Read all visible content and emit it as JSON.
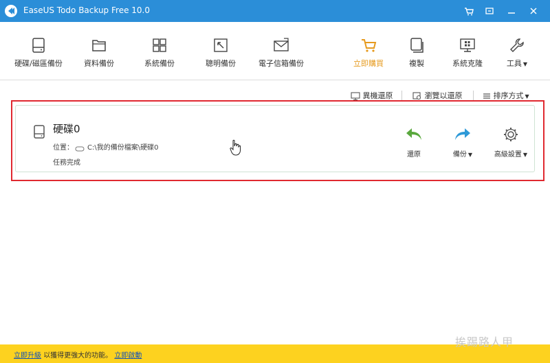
{
  "app": {
    "title": "EaseUS Todo Backup Free 10.0",
    "accent_color": "#2b8ed8",
    "highlight_color": "#e69a1e"
  },
  "titlebar": {
    "controls": [
      "cart-icon",
      "restore-window-icon",
      "minimize-icon",
      "close-icon"
    ]
  },
  "toolbar": {
    "items": [
      {
        "label": "硬碟/磁區備份",
        "icon": "disk-icon"
      },
      {
        "label": "資料備份",
        "icon": "folder-icon"
      },
      {
        "label": "系統備份",
        "icon": "windows-icon"
      },
      {
        "label": "聰明備份",
        "icon": "smart-backup-icon"
      },
      {
        "label": "電子信箱備份",
        "icon": "mail-icon"
      },
      {
        "label": "立即購買",
        "icon": "cart-icon",
        "active": true
      },
      {
        "label": "複製",
        "icon": "clone-icon"
      },
      {
        "label": "系統克隆",
        "icon": "system-clone-icon"
      },
      {
        "label": "工具",
        "icon": "wrench-icon",
        "dropdown": true
      }
    ]
  },
  "subbar": {
    "restore_other": "異機還原",
    "browse_restore": "瀏覽以還原",
    "sort": "排序方式"
  },
  "backup_card": {
    "name": "硬碟0",
    "location_label": "位置：",
    "location_path": "C:\\我的備份檔案\\硬碟0",
    "status": "任務完成",
    "actions": {
      "restore": "還原",
      "backup": "備份",
      "advanced": "高級設置"
    }
  },
  "bottom": {
    "upgrade_link": "立即升級",
    "upgrade_text": "以獲得更強大的功能。",
    "activate_link": "立即啟動"
  },
  "watermark": "挨踢路人甲"
}
